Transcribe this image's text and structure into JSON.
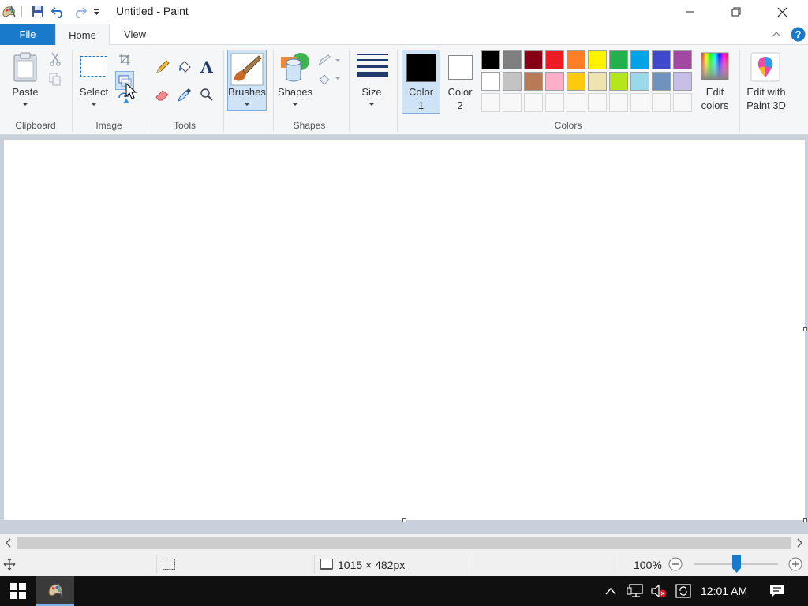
{
  "window": {
    "title": "Untitled - Paint"
  },
  "tabs": {
    "file": "File",
    "home": "Home",
    "view": "View"
  },
  "ribbon": {
    "clipboard": {
      "group_label": "Clipboard",
      "paste_label": "Paste"
    },
    "image": {
      "group_label": "Image",
      "select_label": "Select"
    },
    "tools": {
      "group_label": "Tools"
    },
    "brushes": {
      "label": "Brushes"
    },
    "shapes": {
      "group_label": "Shapes",
      "label": "Shapes"
    },
    "size": {
      "label": "Size"
    },
    "colors": {
      "group_label": "Colors",
      "color1_line1": "Color",
      "color1_line2": "1",
      "color2_line1": "Color",
      "color2_line2": "2",
      "color1_value": "#000000",
      "color2_value": "#ffffff",
      "edit_line1": "Edit",
      "edit_line2": "colors",
      "palette_row1": [
        "#000000",
        "#7f7f7f",
        "#880015",
        "#ed1c24",
        "#ff7f27",
        "#fff200",
        "#22b14c",
        "#00a2e8",
        "#3f48cc",
        "#a349a4"
      ],
      "palette_row2": [
        "#ffffff",
        "#c3c3c3",
        "#b97a57",
        "#ffaec9",
        "#ffc90e",
        "#efe4b0",
        "#b5e61d",
        "#99d9ea",
        "#7092be",
        "#c8bfe7"
      ]
    },
    "paint3d": {
      "line1": "Edit with",
      "line2": "Paint 3D"
    }
  },
  "status": {
    "canvas_size": "1015 × 482px",
    "zoom": "100%",
    "zoom_fraction": 0.5
  },
  "taskbar": {
    "time": "12:01 AM"
  }
}
